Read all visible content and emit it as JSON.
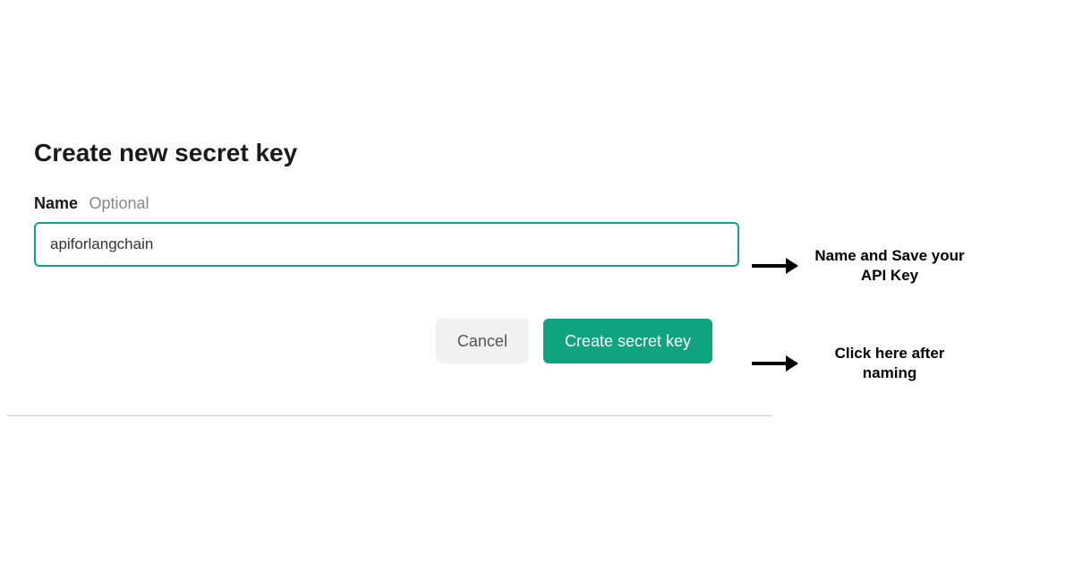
{
  "dialog": {
    "title": "Create new secret key",
    "name_label": "Name",
    "name_optional": "Optional",
    "name_value": "apiforlangchain",
    "cancel_label": "Cancel",
    "create_label": "Create secret key"
  },
  "annotations": {
    "name_save": "Name and Save your API Key",
    "click_after": "Click here after naming"
  },
  "colors": {
    "accent": "#10a37f"
  }
}
